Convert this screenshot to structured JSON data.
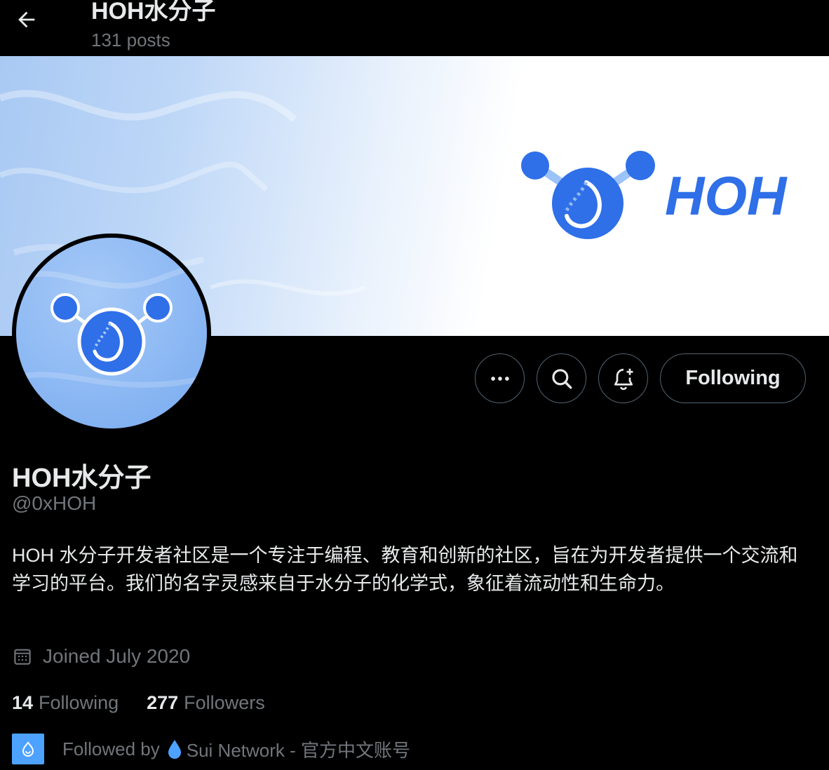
{
  "header": {
    "title": "HOH水分子",
    "posts_count": "131 posts"
  },
  "banner": {
    "logo_text": "HOH"
  },
  "actions": {
    "more_icon": "more-dots-icon",
    "search_icon": "search-icon",
    "notify_icon": "bell-plus-icon",
    "following_label": "Following"
  },
  "profile": {
    "display_name": "HOH水分子",
    "handle": "@0xHOH",
    "bio": "HOH 水分子开发者社区是一个专注于编程、教育和创新的社区，旨在为开发者提供一个交流和学习的平台。我们的名字灵感来自于水分子的化学式，象征着流动性和生命力。",
    "joined": "Joined July 2020",
    "following_count": "14",
    "following_label": "Following",
    "followers_count": "277",
    "followers_label": "Followers",
    "followed_by_prefix": "Followed by",
    "followed_by_name": "Sui Network - 官方中文账号"
  },
  "colors": {
    "background": "#000000",
    "primary_text": "#e7e9ea",
    "secondary_text": "#71767b",
    "border": "#536471",
    "brand_blue": "#2f6fe8",
    "sui_blue": "#4da2ff"
  }
}
